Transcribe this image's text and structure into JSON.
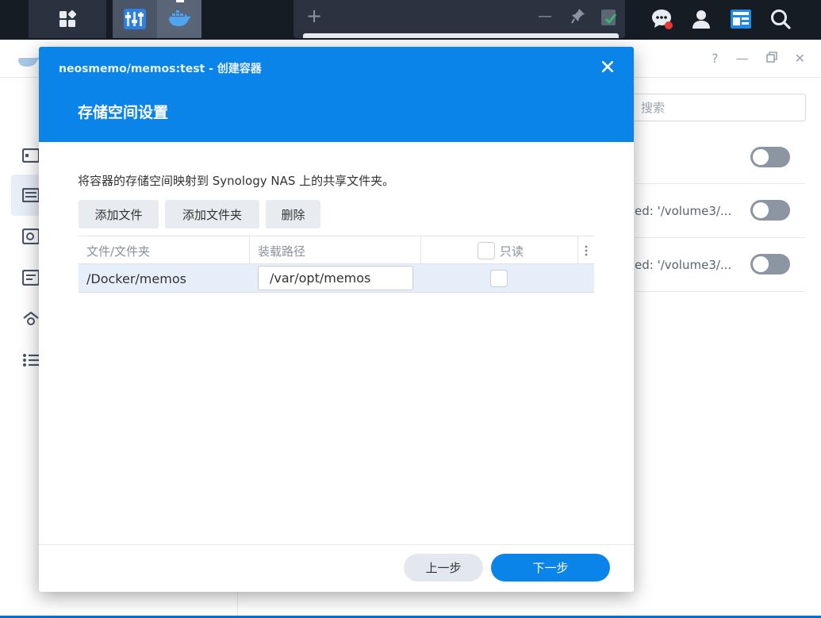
{
  "taskbar": {
    "main_menu_icon": "grid-icon",
    "apps": [
      "control-panel-icon",
      "container-manager-icon"
    ],
    "ghost_window": {
      "add_symbol": "+",
      "min_symbol": "—"
    },
    "right_icons": [
      "chat-icon",
      "user-icon",
      "widgets-icon",
      "search-icon"
    ],
    "notification_color": "#e53935"
  },
  "background_window": {
    "search_placeholder": "搜索",
    "rows": [
      {
        "text": ""
      },
      {
        "text": "ed: '/volume3/..."
      },
      {
        "text": "ed: '/volume3/..."
      }
    ]
  },
  "modal": {
    "title": "neosmemo/memos:test - 创建容器",
    "heading": "存储空间设置",
    "description": "将容器的存储空间映射到 Synology NAS 上的共享文件夹。",
    "buttons": {
      "add_file": "添加文件",
      "add_folder": "添加文件夹",
      "delete": "删除"
    },
    "table": {
      "headers": {
        "file_folder": "文件/文件夹",
        "mount_path": "装载路径",
        "readonly": "只读"
      },
      "rows": [
        {
          "file_folder": "/Docker/memos",
          "mount_path": "/var/opt/memos",
          "readonly": false
        }
      ]
    },
    "footer": {
      "prev": "上一步",
      "next": "下一步"
    },
    "accent_color": "#0b84ea"
  }
}
